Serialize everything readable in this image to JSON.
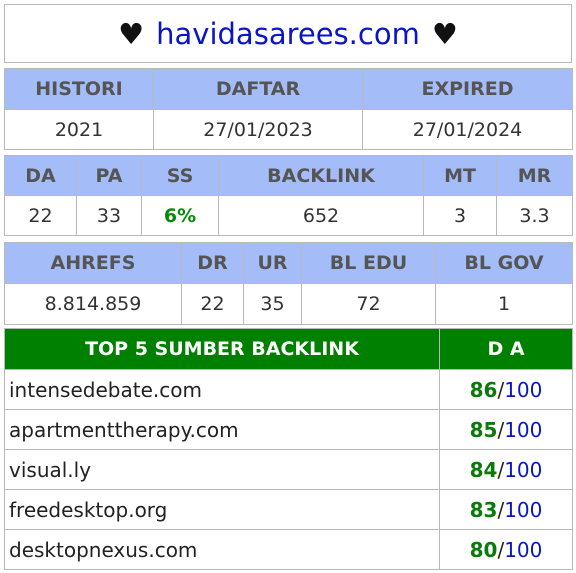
{
  "title": {
    "domain": "havidasarees.com",
    "heart_left": "♥",
    "heart_right": "♥"
  },
  "table1": {
    "headers": [
      "HISTORI",
      "DAFTAR",
      "EXPIRED"
    ],
    "values": [
      "2021",
      "27/01/2023",
      "27/01/2024"
    ]
  },
  "table2": {
    "headers": [
      "DA",
      "PA",
      "SS",
      "BACKLINK",
      "MT",
      "MR"
    ],
    "values": [
      "22",
      "33",
      "6%",
      "652",
      "3",
      "3.3"
    ]
  },
  "table3": {
    "headers": [
      "AHREFS",
      "DR",
      "UR",
      "BL EDU",
      "BL GOV"
    ],
    "values": [
      "8.814.859",
      "22",
      "35",
      "72",
      "1"
    ]
  },
  "backlinks": {
    "header_source": "TOP 5 SUMBER BACKLINK",
    "header_da": "D A",
    "max": "100",
    "sep": "/",
    "rows": [
      {
        "site": "intensedebate.com",
        "da": "86"
      },
      {
        "site": "apartmenttherapy.com",
        "da": "85"
      },
      {
        "site": "visual.ly",
        "da": "84"
      },
      {
        "site": "freedesktop.org",
        "da": "83"
      },
      {
        "site": "desktopnexus.com",
        "da": "80"
      }
    ]
  },
  "colors": {
    "header_blue": "#a4bcf8",
    "header_green": "#008000",
    "domain_blue": "#0a14c8",
    "value_green": "#0a7a0a"
  }
}
